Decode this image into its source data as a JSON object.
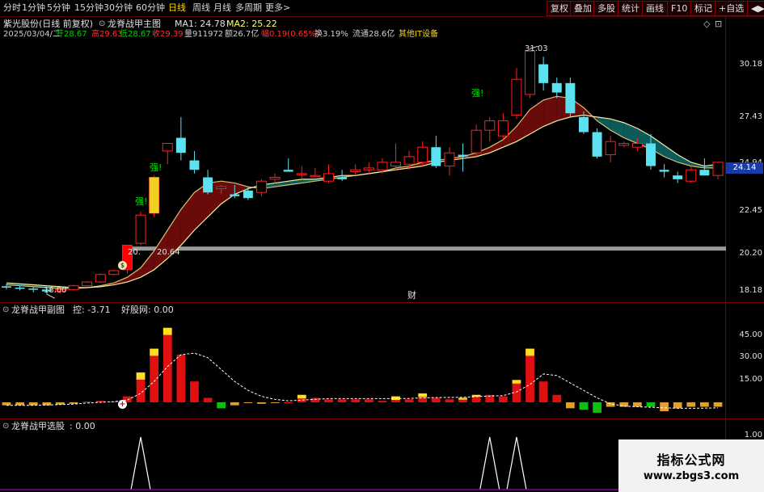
{
  "toolbar": {
    "periods": [
      "分时",
      "1分钟",
      "5分钟",
      "15分钟",
      "30分钟",
      "60分钟",
      "日线",
      "周线",
      "月线",
      "多周期",
      "更多>"
    ],
    "active_period": "日线",
    "right_buttons": [
      "复权",
      "叠加",
      "多股",
      "统计",
      "画线",
      "F10",
      "标记",
      "+自选",
      "◀▶"
    ]
  },
  "header": {
    "stock": "紫光股份(日线 前复权)",
    "indicator": "龙脊战甲主图",
    "ma1": "MA1: 24.78",
    "ma2": "MA2: 25.22",
    "corner_icons": [
      "◇",
      "⊡"
    ],
    "info": [
      {
        "text": "2025/03/04/二",
        "color": "#d0d0d0"
      },
      {
        "text": "开28.67",
        "color": "#00d000"
      },
      {
        "text": "高29.63",
        "color": "#ff3030"
      },
      {
        "text": "低28.67",
        "color": "#00d000"
      },
      {
        "text": "收29.39",
        "color": "#ff3030"
      },
      {
        "text": "量911972",
        "color": "#d0d0d0"
      },
      {
        "text": "额26.7亿",
        "color": "#d0d0d0"
      },
      {
        "text": "幅0.19(0.65%)",
        "color": "#ff3030"
      },
      {
        "text": "换3.19%",
        "color": "#d0d0d0"
      },
      {
        "text": "流通28.6亿",
        "color": "#d0d0d0"
      },
      {
        "text": "其他IT设备",
        "color": "#ffd700"
      }
    ]
  },
  "main_chart": {
    "y_ticks": [
      "30.18",
      "27.43",
      "24.94",
      "22.45",
      "20.20",
      "18.18"
    ],
    "current_price": "24.14",
    "high_label": "31.03",
    "low_label": "18.00",
    "support_label": "20.64",
    "support_label_left": "20.",
    "strong_tags": [
      "强!",
      "强!",
      "强!"
    ],
    "cai_tag": "财",
    "dollar_marker": "$",
    "candles": [
      {
        "o": 18.42,
        "h": 18.55,
        "l": 18.25,
        "c": 18.35
      },
      {
        "o": 18.35,
        "h": 18.45,
        "l": 18.2,
        "c": 18.3
      },
      {
        "o": 18.3,
        "h": 18.4,
        "l": 18.1,
        "c": 18.25
      },
      {
        "o": 18.25,
        "h": 18.38,
        "l": 18.0,
        "c": 18.15
      },
      {
        "o": 18.15,
        "h": 18.3,
        "l": 18.05,
        "c": 18.25
      },
      {
        "o": 18.25,
        "h": 18.5,
        "l": 18.2,
        "c": 18.45
      },
      {
        "o": 18.45,
        "h": 18.7,
        "l": 18.4,
        "c": 18.65
      },
      {
        "o": 18.65,
        "h": 19.1,
        "l": 18.6,
        "c": 19.05
      },
      {
        "o": 19.05,
        "h": 19.3,
        "l": 19.0,
        "c": 19.25
      },
      {
        "o": 19.3,
        "h": 20.64,
        "l": 19.1,
        "c": 20.6
      },
      {
        "o": 20.7,
        "h": 22.4,
        "l": 20.6,
        "c": 22.2
      },
      {
        "o": 22.3,
        "h": 24.3,
        "l": 22.1,
        "c": 24.2
      },
      {
        "o": 25.6,
        "h": 26.0,
        "l": 24.9,
        "c": 26.0
      },
      {
        "o": 26.3,
        "h": 27.4,
        "l": 25.1,
        "c": 25.5
      },
      {
        "o": 25.1,
        "h": 25.6,
        "l": 24.4,
        "c": 24.6
      },
      {
        "o": 24.2,
        "h": 24.6,
        "l": 23.3,
        "c": 23.4
      },
      {
        "o": 23.6,
        "h": 23.8,
        "l": 23.3,
        "c": 23.7
      },
      {
        "o": 23.3,
        "h": 23.8,
        "l": 23.1,
        "c": 23.2
      },
      {
        "o": 23.5,
        "h": 23.7,
        "l": 23.0,
        "c": 23.1
      },
      {
        "o": 23.4,
        "h": 24.1,
        "l": 23.2,
        "c": 24.0
      },
      {
        "o": 24.1,
        "h": 24.4,
        "l": 23.9,
        "c": 24.2
      },
      {
        "o": 24.6,
        "h": 25.2,
        "l": 24.5,
        "c": 24.5
      },
      {
        "o": 24.4,
        "h": 24.8,
        "l": 24.1,
        "c": 24.4
      },
      {
        "o": 24.3,
        "h": 24.7,
        "l": 24.2,
        "c": 24.3
      },
      {
        "o": 24.0,
        "h": 24.9,
        "l": 23.9,
        "c": 24.4
      },
      {
        "o": 24.2,
        "h": 24.6,
        "l": 24.0,
        "c": 24.1
      },
      {
        "o": 24.5,
        "h": 24.9,
        "l": 24.3,
        "c": 24.6
      },
      {
        "o": 24.6,
        "h": 25.0,
        "l": 24.4,
        "c": 24.7
      },
      {
        "o": 24.6,
        "h": 25.2,
        "l": 24.4,
        "c": 25.0
      },
      {
        "o": 24.8,
        "h": 26.0,
        "l": 24.6,
        "c": 25.0
      },
      {
        "o": 24.9,
        "h": 25.6,
        "l": 24.6,
        "c": 25.3
      },
      {
        "o": 25.0,
        "h": 26.1,
        "l": 24.8,
        "c": 25.8
      },
      {
        "o": 25.8,
        "h": 26.4,
        "l": 24.7,
        "c": 24.8
      },
      {
        "o": 24.8,
        "h": 25.8,
        "l": 24.3,
        "c": 25.5
      },
      {
        "o": 25.4,
        "h": 26.0,
        "l": 24.5,
        "c": 25.3
      },
      {
        "o": 25.5,
        "h": 27.0,
        "l": 25.3,
        "c": 26.7
      },
      {
        "o": 26.7,
        "h": 27.4,
        "l": 26.1,
        "c": 27.2
      },
      {
        "o": 26.4,
        "h": 27.6,
        "l": 26.2,
        "c": 27.2
      },
      {
        "o": 27.5,
        "h": 30.0,
        "l": 27.3,
        "c": 29.4
      },
      {
        "o": 28.6,
        "h": 31.03,
        "l": 28.4,
        "c": 30.9
      },
      {
        "o": 30.2,
        "h": 30.6,
        "l": 28.8,
        "c": 29.2
      },
      {
        "o": 29.2,
        "h": 29.5,
        "l": 28.4,
        "c": 28.7
      },
      {
        "o": 29.2,
        "h": 29.5,
        "l": 27.4,
        "c": 27.6
      },
      {
        "o": 27.4,
        "h": 27.7,
        "l": 26.5,
        "c": 26.6
      },
      {
        "o": 26.6,
        "h": 26.8,
        "l": 25.2,
        "c": 25.3
      },
      {
        "o": 25.4,
        "h": 26.4,
        "l": 25.0,
        "c": 26.1
      },
      {
        "o": 25.9,
        "h": 26.1,
        "l": 25.8,
        "c": 26.0
      },
      {
        "o": 25.8,
        "h": 26.3,
        "l": 25.6,
        "c": 26.0
      },
      {
        "o": 26.0,
        "h": 26.5,
        "l": 24.6,
        "c": 24.8
      },
      {
        "o": 24.6,
        "h": 24.9,
        "l": 24.2,
        "c": 24.5
      },
      {
        "o": 24.3,
        "h": 24.5,
        "l": 23.9,
        "c": 24.1
      },
      {
        "o": 24.0,
        "h": 24.8,
        "l": 23.9,
        "c": 24.6
      },
      {
        "o": 24.6,
        "h": 25.2,
        "l": 24.3,
        "c": 24.3
      },
      {
        "o": 24.3,
        "h": 25.0,
        "l": 24.1,
        "c": 25.0
      }
    ],
    "ma_fast": [
      18.5,
      18.45,
      18.4,
      18.35,
      18.3,
      18.3,
      18.35,
      18.45,
      18.6,
      18.9,
      19.4,
      20.3,
      21.4,
      22.5,
      23.4,
      23.9,
      24.0,
      23.9,
      23.7,
      23.6,
      23.7,
      23.8,
      23.9,
      24.0,
      24.1,
      24.2,
      24.3,
      24.4,
      24.5,
      24.7,
      24.8,
      25.0,
      25.1,
      25.2,
      25.3,
      25.5,
      25.8,
      26.2,
      26.9,
      27.8,
      28.3,
      28.5,
      28.4,
      27.9,
      27.2,
      26.7,
      26.3,
      26.0,
      25.7,
      25.3,
      25.0,
      24.8,
      24.7,
      24.7
    ],
    "ma_slow": [
      18.6,
      18.55,
      18.5,
      18.45,
      18.4,
      18.35,
      18.35,
      18.4,
      18.5,
      18.65,
      18.9,
      19.3,
      19.9,
      20.6,
      21.4,
      22.1,
      22.8,
      23.3,
      23.6,
      23.8,
      23.9,
      24.0,
      24.1,
      24.1,
      24.2,
      24.3,
      24.3,
      24.4,
      24.5,
      24.6,
      24.7,
      24.8,
      25.0,
      25.1,
      25.2,
      25.3,
      25.5,
      25.8,
      26.1,
      26.5,
      26.9,
      27.2,
      27.4,
      27.5,
      27.4,
      27.3,
      27.1,
      26.8,
      26.4,
      25.9,
      25.4,
      25.0,
      24.8,
      24.9
    ],
    "support_line": 20.4
  },
  "sub1": {
    "title": "龙脊战甲副图",
    "ctrl": "控: -3.71",
    "good": "好股网: 0.00",
    "y_ticks": [
      "45.00",
      "30.00",
      "15.00"
    ],
    "marker": "+",
    "bars": [
      -2,
      -2,
      -2,
      -2,
      -1.5,
      -1,
      0.5,
      1,
      0.5,
      4,
      20,
      36,
      50,
      32,
      14,
      3,
      -4,
      -2,
      -0.5,
      -1,
      -0.5,
      0,
      5,
      3,
      2,
      2,
      2,
      2,
      1,
      4,
      2,
      6,
      3,
      2,
      3,
      5,
      5,
      4,
      15,
      36,
      14,
      5,
      -4,
      -5,
      -7,
      -3,
      -3,
      -3,
      -3,
      -6,
      -4,
      -3,
      -3,
      -3
    ],
    "yellow_caps": [
      0,
      0,
      0,
      0,
      0,
      0,
      0,
      0,
      0,
      0,
      4,
      4,
      4,
      0,
      0,
      0,
      0,
      0,
      0,
      0,
      0,
      0,
      2,
      0,
      0,
      0,
      0,
      0,
      0,
      2,
      0,
      2,
      0,
      0,
      1,
      1,
      0,
      0,
      2,
      4,
      0,
      0,
      0,
      0,
      0,
      0,
      0,
      0,
      0,
      0,
      0,
      0,
      0,
      0
    ],
    "line": [
      -2,
      -2,
      -2,
      -1.8,
      -1.5,
      -1.2,
      -0.5,
      0,
      0.5,
      1.5,
      6,
      14,
      24,
      32,
      33,
      30,
      22,
      14,
      8,
      4,
      2,
      1,
      1.5,
      2,
      2.5,
      2.5,
      2.5,
      2.5,
      2.5,
      2.5,
      2.6,
      3,
      3.2,
      3.3,
      3.4,
      3.8,
      4.2,
      4.5,
      7,
      12,
      19,
      18,
      13,
      8,
      3,
      -1,
      -2.5,
      -3,
      -3.3,
      -3.7,
      -4,
      -4,
      -3.9,
      -3.7
    ]
  },
  "sub2": {
    "title": "龙脊战甲选股",
    "value": ": 0.00",
    "y_tick": "1.00",
    "spikes": [
      10,
      36,
      38
    ]
  },
  "watermark": {
    "title": "指标公式网",
    "url": "www.zbgs3.com"
  },
  "colors": {
    "up": "#ff2020",
    "down": "#5ce1f0",
    "ma": "#ffff99",
    "band_up": "#6a0b0b",
    "band_down": "#0d5a5a",
    "support": "#9a9a9a"
  }
}
